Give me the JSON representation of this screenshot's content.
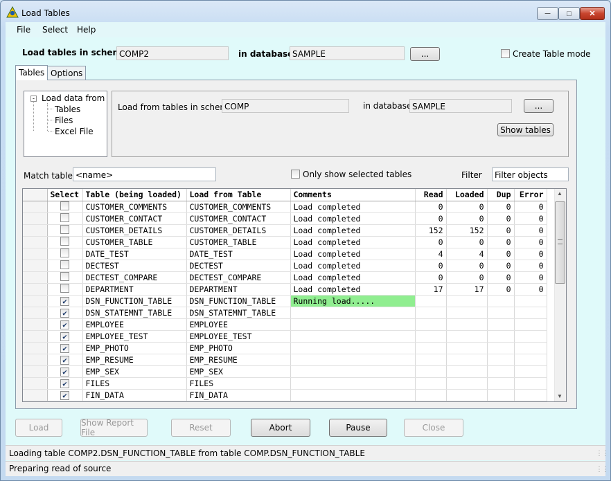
{
  "window": {
    "title": "Load Tables"
  },
  "menu": [
    "File",
    "Select",
    "Help"
  ],
  "target": {
    "schema_label": "Load tables in schema",
    "schema_value": "COMP2",
    "database_label": "in database",
    "database_value": "SAMPLE",
    "browse_label": "...",
    "create_mode_label": "Create Table mode",
    "create_mode_checked": false
  },
  "tabs": [
    {
      "label": "Tables",
      "active": true
    },
    {
      "label": "Options",
      "active": false
    }
  ],
  "tree": {
    "root": "Load data from",
    "children": [
      "Tables",
      "Files",
      "Excel File"
    ],
    "selected": "Tables"
  },
  "source": {
    "schema_label": "Load from tables in schema",
    "schema_value": "COMP",
    "database_label": "in database",
    "database_value": "SAMPLE",
    "browse_label": "...",
    "show_tables_label": "Show tables"
  },
  "filter_bar": {
    "match_label": "Match tables",
    "match_value": "<name>",
    "only_selected_label": "Only show selected tables",
    "only_selected_checked": false,
    "filter_label": "Filter",
    "filter_value": "Filter objects"
  },
  "grid": {
    "columns": [
      "Select",
      "Table (being loaded)",
      "Load from Table",
      "Comments",
      "Read",
      "Loaded",
      "Dup",
      "Error"
    ],
    "rows": [
      {
        "checked": false,
        "table": "CUSTOMER_COMMENTS",
        "from": "CUSTOMER_COMMENTS",
        "comment": "Load completed",
        "read": "0",
        "loaded": "0",
        "dup": "0",
        "error": "0"
      },
      {
        "checked": false,
        "table": "CUSTOMER_CONTACT",
        "from": "CUSTOMER_CONTACT",
        "comment": "Load completed",
        "read": "0",
        "loaded": "0",
        "dup": "0",
        "error": "0"
      },
      {
        "checked": false,
        "table": "CUSTOMER_DETAILS",
        "from": "CUSTOMER_DETAILS",
        "comment": "Load completed",
        "read": "152",
        "loaded": "152",
        "dup": "0",
        "error": "0"
      },
      {
        "checked": false,
        "table": "CUSTOMER_TABLE",
        "from": "CUSTOMER_TABLE",
        "comment": "Load completed",
        "read": "0",
        "loaded": "0",
        "dup": "0",
        "error": "0"
      },
      {
        "checked": false,
        "table": "DATE_TEST",
        "from": "DATE_TEST",
        "comment": "Load completed",
        "read": "4",
        "loaded": "4",
        "dup": "0",
        "error": "0"
      },
      {
        "checked": false,
        "table": "DECTEST",
        "from": "DECTEST",
        "comment": "Load completed",
        "read": "0",
        "loaded": "0",
        "dup": "0",
        "error": "0"
      },
      {
        "checked": false,
        "table": "DECTEST_COMPARE",
        "from": "DECTEST_COMPARE",
        "comment": "Load completed",
        "read": "0",
        "loaded": "0",
        "dup": "0",
        "error": "0"
      },
      {
        "checked": false,
        "table": "DEPARTMENT",
        "from": "DEPARTMENT",
        "comment": "Load completed",
        "read": "17",
        "loaded": "17",
        "dup": "0",
        "error": "0"
      },
      {
        "checked": true,
        "table": "DSN_FUNCTION_TABLE",
        "from": "DSN_FUNCTION_TABLE",
        "comment": "Running load.....",
        "read": "",
        "loaded": "",
        "dup": "",
        "error": "",
        "running": true
      },
      {
        "checked": true,
        "table": "DSN_STATEMNT_TABLE",
        "from": "DSN_STATEMNT_TABLE",
        "comment": "",
        "read": "",
        "loaded": "",
        "dup": "",
        "error": ""
      },
      {
        "checked": true,
        "table": "EMPLOYEE",
        "from": "EMPLOYEE",
        "comment": "",
        "read": "",
        "loaded": "",
        "dup": "",
        "error": ""
      },
      {
        "checked": true,
        "table": "EMPLOYEE_TEST",
        "from": "EMPLOYEE_TEST",
        "comment": "",
        "read": "",
        "loaded": "",
        "dup": "",
        "error": ""
      },
      {
        "checked": true,
        "table": "EMP_PHOTO",
        "from": "EMP_PHOTO",
        "comment": "",
        "read": "",
        "loaded": "",
        "dup": "",
        "error": ""
      },
      {
        "checked": true,
        "table": "EMP_RESUME",
        "from": "EMP_RESUME",
        "comment": "",
        "read": "",
        "loaded": "",
        "dup": "",
        "error": ""
      },
      {
        "checked": true,
        "table": "EMP_SEX",
        "from": "EMP_SEX",
        "comment": "",
        "read": "",
        "loaded": "",
        "dup": "",
        "error": ""
      },
      {
        "checked": true,
        "table": "FILES",
        "from": "FILES",
        "comment": "",
        "read": "",
        "loaded": "",
        "dup": "",
        "error": ""
      },
      {
        "checked": true,
        "table": "FIN_DATA",
        "from": "FIN_DATA",
        "comment": "",
        "read": "",
        "loaded": "",
        "dup": "",
        "error": ""
      }
    ]
  },
  "buttons": {
    "load": "Load",
    "report": "Show Report File",
    "reset": "Reset",
    "abort": "Abort",
    "pause": "Pause",
    "close": "Close"
  },
  "status": {
    "line1": "Loading table COMP2.DSN_FUNCTION_TABLE from table COMP.DSN_FUNCTION_TABLE",
    "line2": "Preparing read of source"
  },
  "colors": {
    "running": "#90ee90",
    "client_bg": "#e0fafa"
  },
  "icons": [
    "app-icon",
    "minimize-icon",
    "maximize-icon",
    "close-icon",
    "checkbox-icon",
    "scroll-up-icon",
    "scroll-down-icon",
    "size-grip-icon"
  ]
}
